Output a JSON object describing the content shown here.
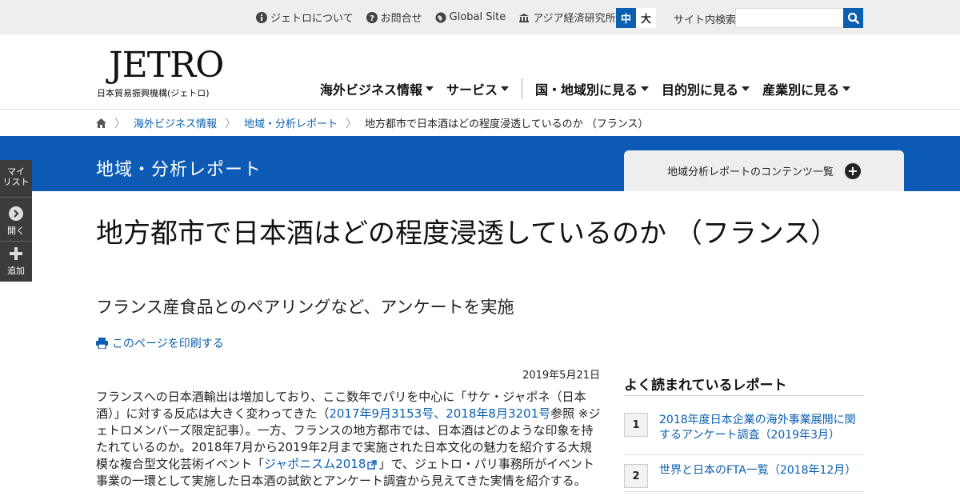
{
  "utility": {
    "links": [
      {
        "label": "ジェトロについて",
        "icon": "info-icon"
      },
      {
        "label": "お問合せ",
        "icon": "help-icon"
      },
      {
        "label": "Global Site",
        "icon": "globe-icon"
      },
      {
        "label": "アジア経済研究所",
        "icon": "building-icon"
      }
    ],
    "font_size_medium": "中",
    "font_size_large": "大",
    "search_label": "サイト内検索",
    "search_value": ""
  },
  "header": {
    "logo_text": "JETRO",
    "logo_sub": "日本貿易振興機構(ジェトロ)",
    "nav": [
      {
        "label": "海外ビジネス情報"
      },
      {
        "label": "サービス"
      },
      {
        "label": "国・地域別に見る"
      },
      {
        "label": "目的別に見る"
      },
      {
        "label": "産業別に見る"
      }
    ]
  },
  "breadcrumb": {
    "items": [
      "海外ビジネス情報",
      "地域・分析レポート"
    ],
    "current": "地方都市で日本酒はどの程度浸透しているのか （フランス）"
  },
  "band": {
    "title": "地域・分析レポート",
    "tab_label": "地域分析レポートのコンテンツ一覧",
    "tab_icon": "+"
  },
  "side_tools": {
    "mylist": [
      "マイ",
      "リスト"
    ],
    "open": "開く",
    "add": "追加"
  },
  "article": {
    "title": "地方都市で日本酒はどの程度浸透しているのか （フランス）",
    "subtitle": "フランス産食品とのペアリングなど、アンケートを実施",
    "print_label": "このページを印刷する",
    "date": "2019年5月21日",
    "body": {
      "p1_a": "フランスへの日本酒輸出は増加しており、ここ数年でパリを中心に「サケ・ジャポネ（日本酒）」に対する反応は大きく変わってきた（",
      "link1": "2017年9月3153号",
      "sep": "、",
      "link2": "2018年8月3201号",
      "p1_b": "参照 ※ジェトロメンバーズ限定記事）。一方、フランスの地方都市では、日本酒はどのような印象を持たれているのか。2018年7月から2019年2月まで実施された日本文化の魅力を紹介する大規模な複合型文化芸術イベント「",
      "link3": "ジャポニスム2018",
      "p1_c": "」で、ジェトロ・パリ事務所がイベント事業の一環として実施した日本酒の試飲とアンケート調査から見えてきた実情を紹介する。"
    }
  },
  "ranking": {
    "title": "よく読まれているレポート",
    "items": [
      {
        "rank": "1",
        "label": "2018年度日本企業の海外事業展開に関するアンケート調査（2019年3月）"
      },
      {
        "rank": "2",
        "label": "世界と日本のFTA一覧（2018年12月）"
      }
    ]
  },
  "colors": {
    "brand_blue": "#0d5bb5",
    "link_blue": "#0b5fb0",
    "utility_bg": "#eeeeee",
    "side_bg": "#3b3b3b"
  }
}
